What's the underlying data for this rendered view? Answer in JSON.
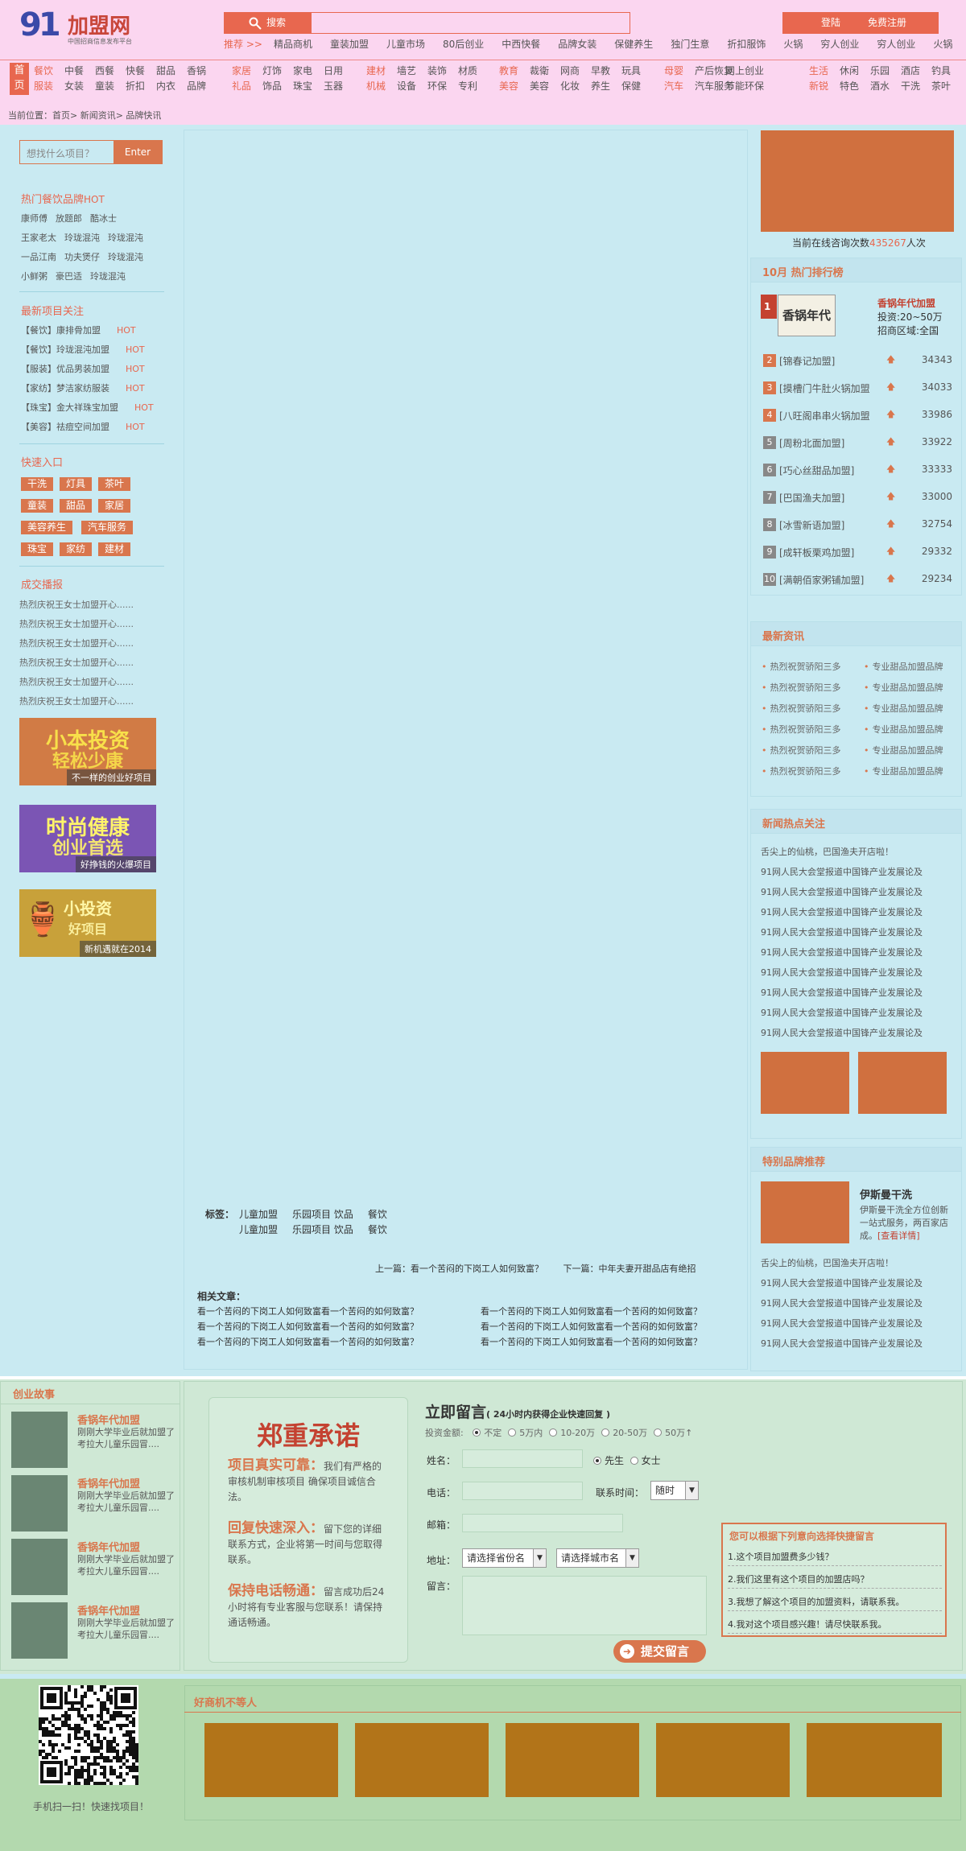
{
  "site": {
    "logo_num": "91",
    "logo_text": "加盟网",
    "slogan": "中国招商信息发布平台"
  },
  "search": {
    "button": "搜索",
    "placeholder": ""
  },
  "user": {
    "login": "登陆",
    "register": "免费注册"
  },
  "reco": {
    "label": "推荐 >>",
    "items": [
      "精品商机",
      "童装加盟",
      "儿童市场",
      "80后创业",
      "中西快餐",
      "品牌女装",
      "保健养生",
      "独门生意",
      "折扣服饰",
      "火锅",
      "穷人创业",
      "穷人创业",
      "火锅"
    ]
  },
  "home": "首页",
  "cats": [
    {
      "hl": [
        "餐饮",
        "服装"
      ],
      "r1": [
        "中餐",
        "西餐",
        "快餐",
        "甜品",
        "香锅"
      ],
      "r2": [
        "女装",
        "童装",
        "折扣",
        "内衣",
        "品牌"
      ]
    },
    {
      "hl": [
        "家居",
        "礼品"
      ],
      "r1": [
        "灯饰",
        "家电",
        "日用"
      ],
      "r2": [
        "饰品",
        "珠宝",
        "玉器"
      ]
    },
    {
      "hl": [
        "建材",
        "机械"
      ],
      "r1": [
        "墙艺",
        "装饰",
        "材质"
      ],
      "r2": [
        "设备",
        "环保",
        "专利"
      ]
    },
    {
      "hl": [
        "教育",
        "美容"
      ],
      "r1": [
        "裁衛",
        "网商",
        "早教",
        "玩具"
      ],
      "r2": [
        "美容",
        "化妆",
        "养生",
        "保健"
      ]
    },
    {
      "hl": [
        "母婴",
        "汽车"
      ],
      "r1": [
        "产后恢复",
        "网上创业"
      ],
      "r2": [
        "汽车服务",
        "节能环保"
      ]
    },
    {
      "hl": [
        "生活",
        "新锐"
      ],
      "r1": [
        "休闲",
        "乐园",
        "酒店",
        "钓具"
      ],
      "r2": [
        "特色",
        "酒水",
        "干洗",
        "茶叶"
      ]
    }
  ],
  "crumb": "当前位置：首页> 新闻资讯> 品牌快讯",
  "left": {
    "search_ph": "想找什么项目？",
    "search_btn": "Enter",
    "hot_title": "热门餐饮品牌",
    "hot_tag": "HOT",
    "hot_rows": [
      [
        "康师傅",
        "放题郎",
        "酷冰士"
      ],
      [
        "王家老太",
        "玲珑混沌",
        "玲珑混沌"
      ],
      [
        "一品江南",
        "功夫煲仔",
        "玲珑混沌"
      ],
      [
        "小鲜粥",
        "豪巴适",
        "玲珑混沌"
      ]
    ],
    "new_title": "最新项目关注",
    "new_items": [
      [
        "【餐饮】康排骨加盟",
        "HOT"
      ],
      [
        "【餐饮】玲珑混沌加盟",
        "HOT"
      ],
      [
        "【服装】优品男装加盟",
        "HOT"
      ],
      [
        "【家纺】梦洁家纺服装",
        "HOT"
      ],
      [
        "【珠宝】金大祥珠宝加盟",
        "HOT"
      ],
      [
        "【美容】祛痘空间加盟",
        "HOT"
      ]
    ],
    "quick_title": "快速入口",
    "quick_tags": [
      "干洗",
      "灯具",
      "茶叶",
      "童装",
      "甜品",
      "家居",
      "美容养生",
      "汽车服务",
      "珠宝",
      "家纺",
      "建材"
    ],
    "deal_title": "成交播报",
    "deals": [
      "热烈庆祝王女士加盟开心......",
      "热烈庆祝王女士加盟开心......",
      "热烈庆祝王女士加盟开心......",
      "热烈庆祝王女士加盟开心......",
      "热烈庆祝王女士加盟开心......",
      "热烈庆祝王女士加盟开心......"
    ],
    "ads": [
      {
        "big": "小本投资",
        "sub": "轻松少康",
        "cap": "不一样的创业好项目",
        "bg": "#d17b45",
        "fg": "#f8e04a"
      },
      {
        "big": "时尚健康",
        "sub": "创业首选",
        "cap": "好挣钱的火爆项目",
        "bg": "#7b55b4",
        "fg": "#fff46a"
      },
      {
        "big": "小投资",
        "sub": "好项目",
        "cap": "新机遇就在2014",
        "bg": "#c8a13a",
        "fg": "#fff7a8"
      }
    ]
  },
  "center": {
    "tags_label": "标签：",
    "tags_r1": [
      "儿童加盟",
      "乐园项目 饮品",
      "餐饮"
    ],
    "tags_r2": [
      "儿童加盟",
      "乐园项目 饮品",
      "餐饮"
    ],
    "prev": "上一篇：看一个苦闷的下岗工人如何致富？",
    "next": "下一篇：中年夫妻开甜品店有绝招",
    "related_title": "相关文章：",
    "related": [
      "看一个苦闷的下岗工人如何致富看一个苦闷的如何致富？",
      "看一个苦闷的下岗工人如何致富看一个苦闷的如何致富？",
      "看一个苦闷的下岗工人如何致富看一个苦闷的如何致富？",
      "看一个苦闷的下岗工人如何致富看一个苦闷的如何致富？",
      "看一个苦闷的下岗工人如何致富看一个苦闷的如何致富？",
      "看一个苦闷的下岗工人如何致富看一个苦闷的如何致富？"
    ]
  },
  "right": {
    "online_pre": "当前在线咨询次数",
    "online_num": "435267",
    "online_post": "人次",
    "rank_title": "10月 热门排行榜",
    "top": {
      "name": "香锅年代加盟",
      "invest": "投资:20~50万",
      "area": "招商区域:全国",
      "logo": "香锅年代"
    },
    "ranks": [
      [
        "2",
        "[锦春记加盟]",
        "34343"
      ],
      [
        "3",
        "[摸槽门牛肚火锅加盟",
        "34033"
      ],
      [
        "4",
        "[八旺阁串串火锅加盟",
        "33986"
      ],
      [
        "5",
        "[周粉北面加盟]",
        "33922"
      ],
      [
        "6",
        "[巧心丝甜品加盟]",
        "33333"
      ],
      [
        "7",
        "[巴国渔夫加盟]",
        "33000"
      ],
      [
        "8",
        "[冰雪新语加盟]",
        "32754"
      ],
      [
        "9",
        "[成轩板栗鸡加盟]",
        "29332"
      ],
      [
        "10",
        "[满朝佰家粥铺加盟]",
        "29234"
      ]
    ],
    "news_title": "最新资讯",
    "news_l": [
      "热烈祝贺骄阳三多",
      "热烈祝贺骄阳三多",
      "热烈祝贺骄阳三多",
      "热烈祝贺骄阳三多",
      "热烈祝贺骄阳三多",
      "热烈祝贺骄阳三多"
    ],
    "news_r": [
      "专业甜品加盟品牌",
      "专业甜品加盟品牌",
      "专业甜品加盟品牌",
      "专业甜品加盟品牌",
      "专业甜品加盟品牌",
      "专业甜品加盟品牌"
    ],
    "hot_title": "新闻热点关注",
    "hot": [
      "舌尖上的仙桃，巴国渔夫开店啦！",
      "91网人民大会堂报道中国锋产业发展论及",
      "91网人民大会堂报道中国锋产业发展论及",
      "91网人民大会堂报道中国锋产业发展论及",
      "91网人民大会堂报道中国锋产业发展论及",
      "91网人民大会堂报道中国锋产业发展论及",
      "91网人民大会堂报道中国锋产业发展论及",
      "91网人民大会堂报道中国锋产业发展论及",
      "91网人民大会堂报道中国锋产业发展论及",
      "91网人民大会堂报道中国锋产业发展论及"
    ],
    "brand_title": "特别品牌推荐",
    "brand_name": "伊斯曼干洗",
    "brand_desc": "伊斯曼干洗全方位创新一站式服务，两百家店成。",
    "brand_more": "[查看详情]",
    "brand_news": [
      "舌尖上的仙桃，巴国渔夫开店啦！",
      "91网人民大会堂报道中国锋产业发展论及",
      "91网人民大会堂报道中国锋产业发展论及",
      "91网人民大会堂报道中国锋产业发展论及",
      "91网人民大会堂报道中国锋产业发展论及"
    ]
  },
  "story": {
    "title": "创业故事",
    "items": [
      {
        "t": "香锅年代加盟",
        "d": "刚刚大学毕业后就加盟了考拉大儿童乐园冒...."
      },
      {
        "t": "香锅年代加盟",
        "d": "刚刚大学毕业后就加盟了考拉大儿童乐园冒...."
      },
      {
        "t": "香锅年代加盟",
        "d": "刚刚大学毕业后就加盟了考拉大儿童乐园冒...."
      },
      {
        "t": "香锅年代加盟",
        "d": "刚刚大学毕业后就加盟了考拉大儿童乐园冒...."
      }
    ]
  },
  "promise": {
    "title": "郑重承诺",
    "items": [
      {
        "h": "项目真实可靠：",
        "d": "我们有严格的审核机制审核项目 确保项目诚信合法。"
      },
      {
        "h": "回复快速深入：",
        "d": "留下您的详细联系方式，企业将第一时间与您取得联系。"
      },
      {
        "h": "保持电话畅通：",
        "d": "留言成功后24小时将有专业客服与您联系！请保持通话畅通。"
      }
    ]
  },
  "form": {
    "title": "立即留言",
    "subtitle": "( 24小时内获得企业快速回复 )",
    "amount_label": "投资金额:",
    "amounts": [
      "不定",
      "5万内",
      "10-20万",
      "20-50万",
      "50万↑"
    ],
    "name": "姓名：",
    "male": "先生",
    "female": "女士",
    "phone": "电话：",
    "time_label": "联系时间：",
    "time_val": "随时",
    "email": "邮箱：",
    "addr": "地址：",
    "prov": "请选择省份名",
    "city": "请选择城市名",
    "msg": "留言：",
    "submit": "提交留言",
    "quick_title": "您可以根据下列意向选择快捷留言",
    "quick": [
      "1.这个项目加盟费多少钱？",
      "2.我们这里有这个项目的加盟店吗？",
      "3.我想了解这个项目的加盟资料，请联系我。",
      "4.我对这个项目感兴趣！请尽快联系我。"
    ]
  },
  "footer": {
    "qr_caption": "手机扫一扫！快速找项目！",
    "goods_title": "好商机不等人"
  }
}
